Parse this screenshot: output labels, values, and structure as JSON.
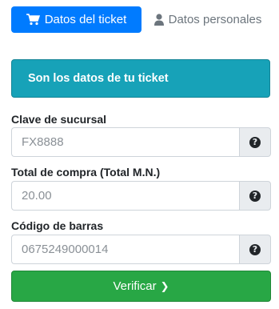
{
  "tabs": [
    {
      "label": "Datos del ticket",
      "icon": "shopping-cart-icon",
      "active": true
    },
    {
      "label": "Datos personales",
      "icon": "user-icon",
      "active": false
    }
  ],
  "banner": {
    "text": "Son los datos de tu ticket"
  },
  "fields": [
    {
      "label": "Clave de sucursal",
      "placeholder": "FX8888",
      "help_icon": "question-circle-icon"
    },
    {
      "label": "Total de compra (Total M.N.)",
      "placeholder": "20.00",
      "help_icon": "question-circle-icon"
    },
    {
      "label": "Código de barras",
      "placeholder": "0675249000014",
      "help_icon": "question-circle-icon"
    }
  ],
  "verify_button": {
    "label": "Verificar",
    "icon": "chevron-right-icon"
  },
  "colors": {
    "primary": "#007bff",
    "info": "#17a2b8",
    "success": "#28a745",
    "muted": "#6c757d",
    "addon_bg": "#e9ecef"
  }
}
